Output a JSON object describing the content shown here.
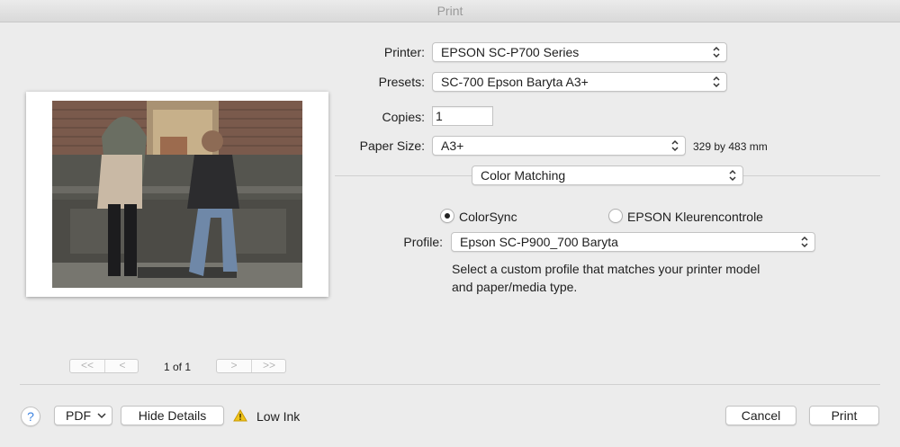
{
  "window": {
    "title": "Print"
  },
  "printer": {
    "label": "Printer:",
    "value": "EPSON SC-P700 Series"
  },
  "presets": {
    "label": "Presets:",
    "value": "SC-700 Epson Baryta A3+"
  },
  "copies": {
    "label": "Copies:",
    "value": "1"
  },
  "paper_size": {
    "label": "Paper Size:",
    "value": "A3+",
    "dimensions": "329 by 483 mm"
  },
  "section": {
    "value": "Color Matching"
  },
  "color_matching": {
    "options": [
      {
        "label": "ColorSync",
        "selected": true
      },
      {
        "label": "EPSON Kleurencontrole",
        "selected": false
      }
    ],
    "profile_label": "Profile:",
    "profile_value": "Epson SC-P900_700 Baryta",
    "description_line1": "Select a custom profile that matches your printer model",
    "description_line2": "and paper/media type."
  },
  "pager": {
    "text": "1 of 1",
    "first": "<<",
    "prev": "<",
    "next": ">",
    "last": ">>"
  },
  "footer": {
    "help": "?",
    "pdf": "PDF",
    "hide_details": "Hide Details",
    "low_ink": "Low Ink",
    "cancel": "Cancel",
    "print": "Print"
  },
  "colors": {
    "warning": "#f0c419",
    "help": "#3b82e0",
    "background": "#ececec"
  },
  "icons": {
    "popup": "updown-chevron-icon",
    "menu": "chevron-down-icon",
    "warning": "warning-triangle-icon"
  }
}
